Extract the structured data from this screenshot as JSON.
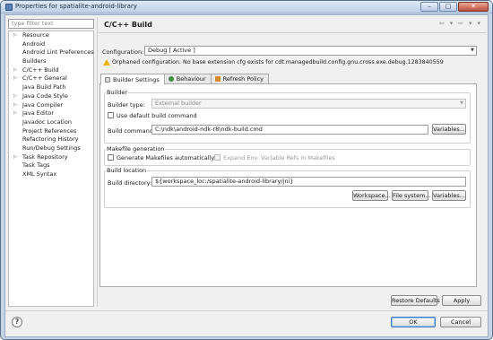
{
  "window": {
    "title": "Properties for spatialite-android-library",
    "buttons": {
      "minimize": "–",
      "maximize": "□",
      "close": "✕"
    }
  },
  "sidebar": {
    "filter_placeholder": "type filter text",
    "items": [
      {
        "label": "Resource",
        "expandable": true
      },
      {
        "label": "Android",
        "expandable": false
      },
      {
        "label": "Android Lint Preferences",
        "expandable": false
      },
      {
        "label": "Builders",
        "expandable": false
      },
      {
        "label": "C/C++ Build",
        "expandable": true
      },
      {
        "label": "C/C++ General",
        "expandable": true
      },
      {
        "label": "Java Build Path",
        "expandable": false
      },
      {
        "label": "Java Code Style",
        "expandable": true
      },
      {
        "label": "Java Compiler",
        "expandable": true
      },
      {
        "label": "Java Editor",
        "expandable": true
      },
      {
        "label": "Javadoc Location",
        "expandable": false
      },
      {
        "label": "Project References",
        "expandable": false
      },
      {
        "label": "Refactoring History",
        "expandable": false
      },
      {
        "label": "Run/Debug Settings",
        "expandable": false
      },
      {
        "label": "Task Repository",
        "expandable": true
      },
      {
        "label": "Task Tags",
        "expandable": false
      },
      {
        "label": "XML Syntax",
        "expandable": false
      }
    ]
  },
  "page": {
    "title": "C/C++ Build",
    "nav": {
      "back": "⇦",
      "back_menu": "▾",
      "forward": "⇨",
      "forward_menu": "▾",
      "menu": "▾"
    }
  },
  "configuration": {
    "label": "Configuration:",
    "value": "Debug  [ Active ]",
    "warning": "Orphaned configuration. No base extension cfg exists for cdt.managedbuild.config.gnu.cross.exe.debug.1283840559"
  },
  "tabs": [
    {
      "label": "Builder Settings",
      "active": true
    },
    {
      "label": "Behaviour",
      "active": false
    },
    {
      "label": "Refresh Policy",
      "active": false
    }
  ],
  "builder": {
    "group_title": "Builder",
    "type_label": "Builder type:",
    "type_value": "External builder",
    "use_default_label": "Use default build command",
    "command_label": "Build command:",
    "command_value": "C:\\ndk\\android-ndk-r8\\ndk-build.cmd",
    "variables_button": "Variables..."
  },
  "makefile": {
    "group_title": "Makefile generation",
    "generate_label": "Generate Makefiles automatically",
    "expand_label": "Expand Env. Variable Refs in Makefiles"
  },
  "build_location": {
    "group_title": "Build location",
    "directory_label": "Build directory:",
    "directory_value": "${workspace_loc:/spatialite-android-library/jni}",
    "workspace_button": "Workspace...",
    "filesystem_button": "File system...",
    "variables_button": "Variables..."
  },
  "footer": {
    "restore_defaults": "Restore Defaults",
    "apply": "Apply",
    "ok": "OK",
    "cancel": "Cancel",
    "help": "?"
  }
}
